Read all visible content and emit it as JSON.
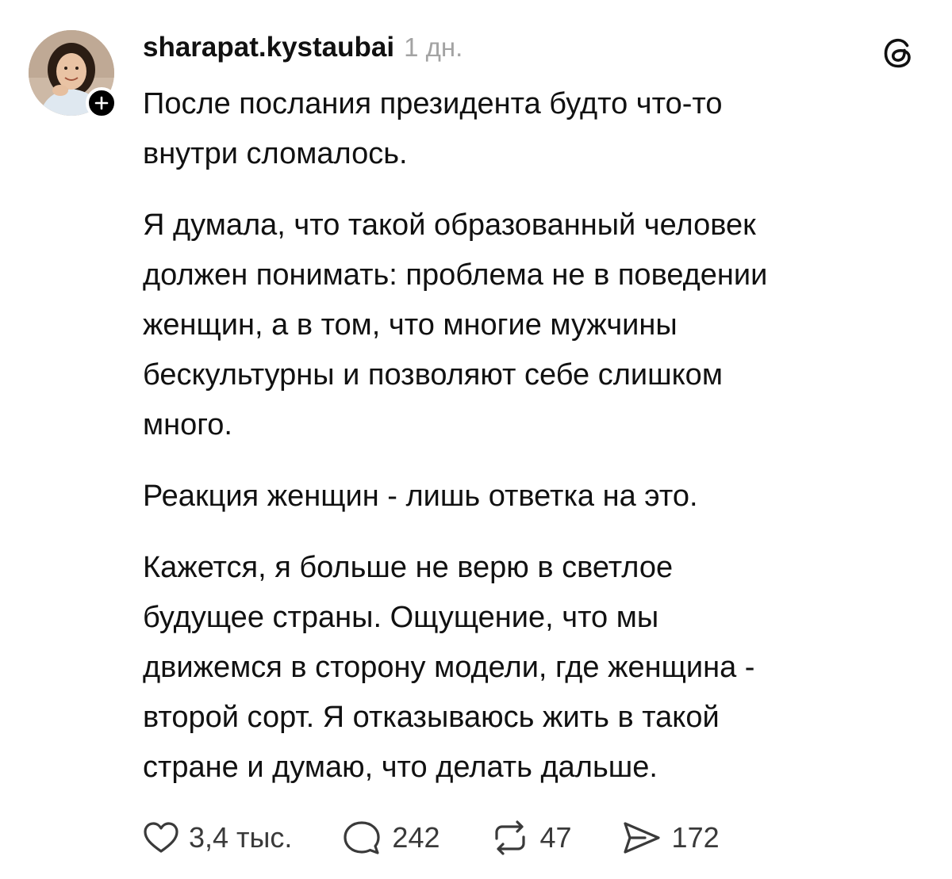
{
  "post": {
    "username": "sharapat.kystaubai",
    "timestamp": "1 дн.",
    "paragraphs": [
      "После послания президента будто что-то\nвнутри сломалось.",
      "Я думала, что такой образованный человек\nдолжен понимать: проблема не в поведении\nженщин, а в том, что многие мужчины\nбескультурны и позволяют себе слишком\nмного.",
      "Реакция женщин - лишь ответка на это.",
      "Кажется, я больше не верю в светлое\nбудущее страны. Ощущение, что мы\nдвижемся в сторону модели, где женщина -\nвторой сорт. Я отказываюсь жить в такой\nстране и думаю, что делать дальше."
    ]
  },
  "actions": {
    "likes": "3,4 тыс.",
    "replies": "242",
    "reposts": "47",
    "shares": "172"
  },
  "icons": {
    "like": "heart-icon",
    "reply": "comment-bubble-icon",
    "repost": "repost-arrows-icon",
    "share": "send-arrow-icon",
    "brand": "threads-logo-icon",
    "follow": "plus-icon"
  },
  "colors": {
    "text": "#111111",
    "muted": "#a3a3a3",
    "icon": "#3a3a3a",
    "background": "#ffffff"
  }
}
